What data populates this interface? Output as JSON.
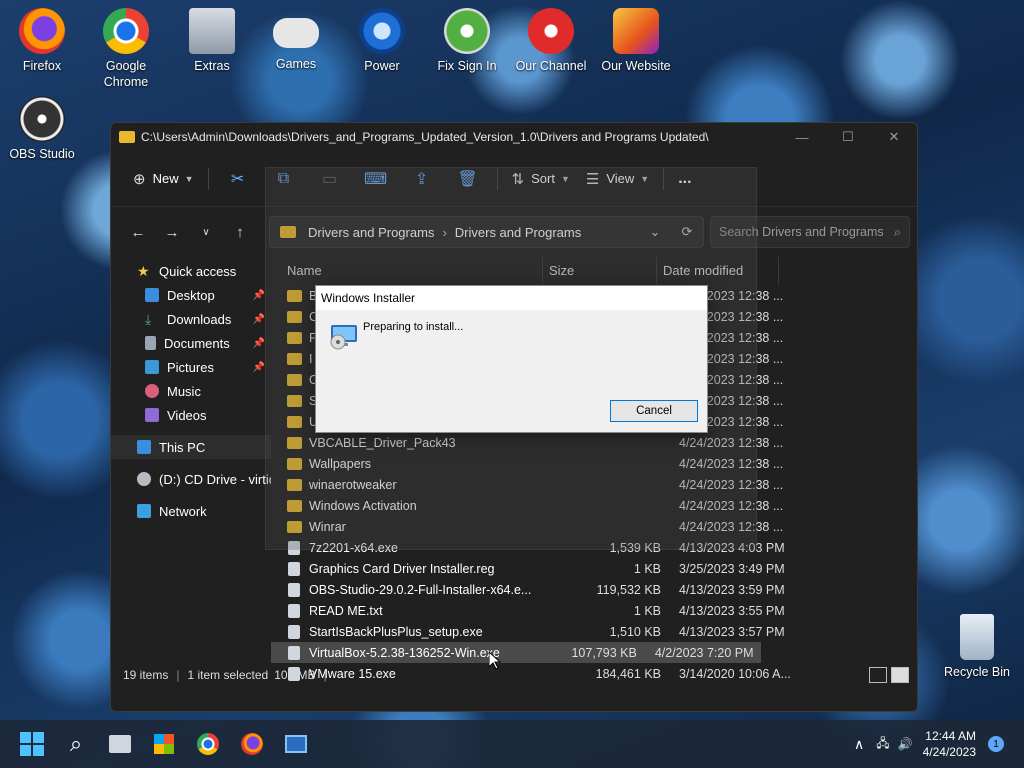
{
  "desktop": {
    "icons": [
      {
        "label": "Firefox"
      },
      {
        "label": "Google Chrome"
      },
      {
        "label": "Extras"
      },
      {
        "label": "Games"
      },
      {
        "label": "Power"
      },
      {
        "label": "Fix Sign In"
      },
      {
        "label": "Our Channel"
      },
      {
        "label": "Our Website"
      },
      {
        "label": "OBS Studio"
      },
      {
        "label": "Recycle Bin"
      }
    ]
  },
  "explorer": {
    "title_path": "C:\\Users\\Admin\\Downloads\\Drivers_and_Programs_Updated_Version_1.0\\Drivers and Programs Updated\\",
    "toolbar": {
      "new": "New",
      "sort": "Sort",
      "view": "View",
      "more": "..."
    },
    "breadcrumb": [
      "Drivers and Programs",
      "Drivers and Programs"
    ],
    "search_placeholder": "Search Drivers and Programs",
    "sidebar": {
      "quick_access": "Quick access",
      "desktop": "Desktop",
      "downloads": "Downloads",
      "documents": "Documents",
      "pictures": "Pictures",
      "music": "Music",
      "videos": "Videos",
      "this_pc": "This PC",
      "cd_drive": "(D:) CD Drive - virtio",
      "network": "Network"
    },
    "columns": {
      "name": "Name",
      "size": "Size",
      "date": "Date modified"
    },
    "rows": [
      {
        "name": "B",
        "size": "",
        "date": "4/24/2023 12:38 ..."
      },
      {
        "name": "C",
        "size": "",
        "date": "4/24/2023 12:38 ..."
      },
      {
        "name": "F",
        "size": "",
        "date": "4/24/2023 12:38 ..."
      },
      {
        "name": "I",
        "size": "",
        "date": "4/24/2023 12:38 ..."
      },
      {
        "name": "O",
        "size": "",
        "date": "4/24/2023 12:38 ..."
      },
      {
        "name": "S",
        "size": "",
        "date": "4/24/2023 12:38 ..."
      },
      {
        "name": "U",
        "size": "",
        "date": "4/24/2023 12:38 ..."
      },
      {
        "name": "VBCABLE_Driver_Pack43",
        "size": "",
        "date": "4/24/2023 12:38 ..."
      },
      {
        "name": "Wallpapers",
        "size": "",
        "date": "4/24/2023 12:38 ..."
      },
      {
        "name": "winaerotweaker",
        "size": "",
        "date": "4/24/2023 12:38 ..."
      },
      {
        "name": "Windows Activation",
        "size": "",
        "date": "4/24/2023 12:38 ..."
      },
      {
        "name": "Winrar",
        "size": "",
        "date": "4/24/2023 12:38 ..."
      },
      {
        "name": "7z2201-x64.exe",
        "size": "1,539 KB",
        "date": "4/13/2023 4:03 PM"
      },
      {
        "name": "Graphics Card Driver Installer.reg",
        "size": "1 KB",
        "date": "3/25/2023 3:49 PM"
      },
      {
        "name": "OBS-Studio-29.0.2-Full-Installer-x64.e...",
        "size": "119,532 KB",
        "date": "4/13/2023 3:59 PM"
      },
      {
        "name": "READ ME.txt",
        "size": "1 KB",
        "date": "4/13/2023 3:55 PM"
      },
      {
        "name": "StartIsBackPlusPlus_setup.exe",
        "size": "1,510 KB",
        "date": "4/13/2023 3:57 PM"
      },
      {
        "name": "VirtualBox-5.2.38-136252-Win.exe",
        "size": "107,793 KB",
        "date": "4/2/2023 7:20 PM"
      },
      {
        "name": "VMware 15.exe",
        "size": "184,461 KB",
        "date": "3/14/2020 10:06 A..."
      }
    ],
    "status": {
      "items": "19 items",
      "selected": "1 item selected",
      "size": "105 MB"
    }
  },
  "dialog": {
    "title": "Windows Installer",
    "message": "Preparing to install...",
    "cancel": "Cancel"
  },
  "taskbar": {
    "time": "12:44 AM",
    "date": "4/24/2023",
    "notification_count": "1"
  }
}
